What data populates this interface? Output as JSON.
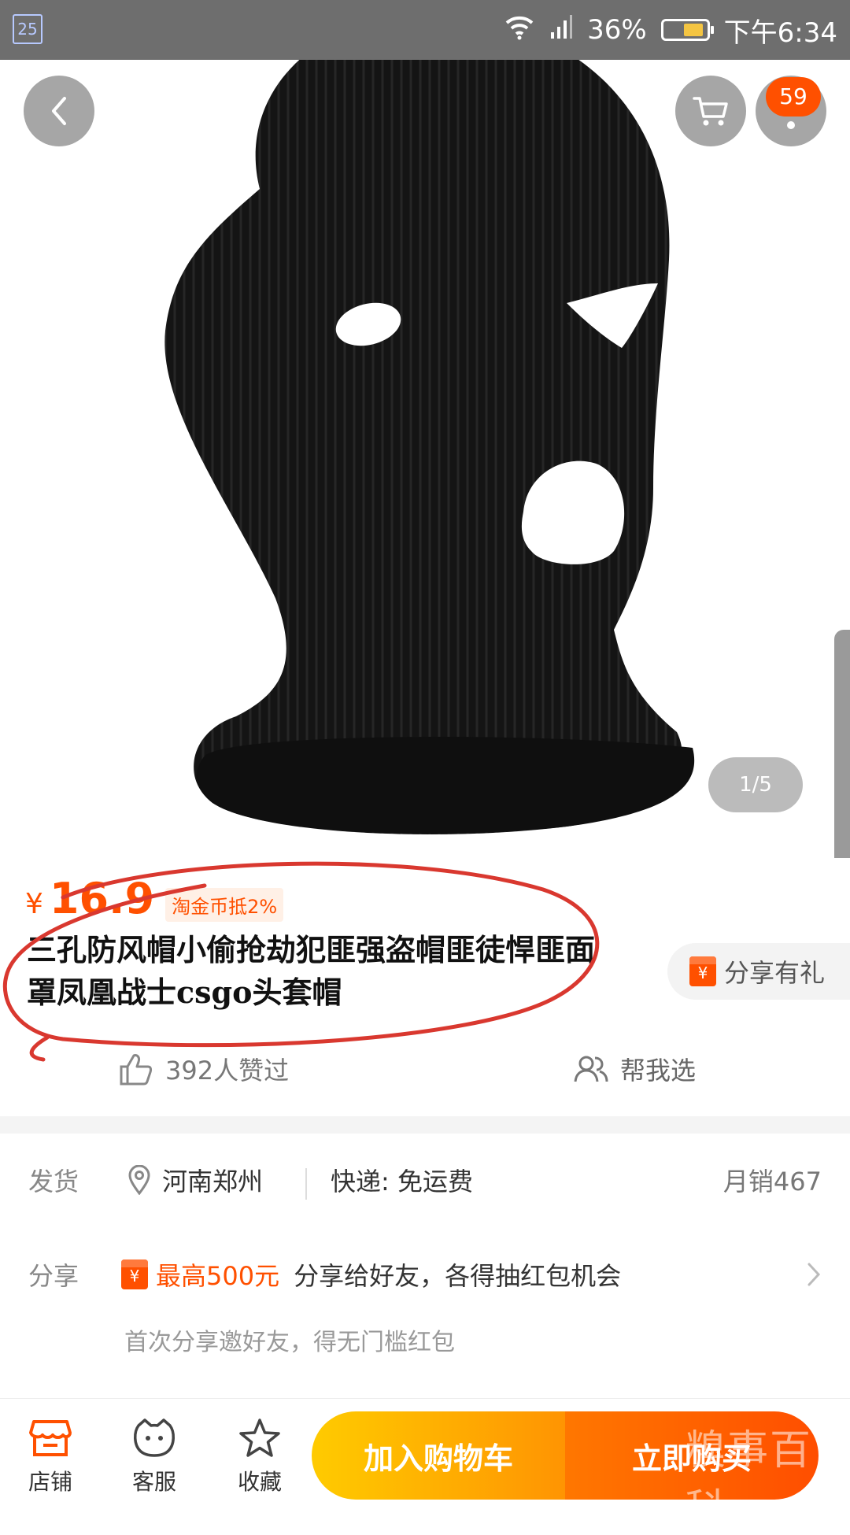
{
  "status_bar": {
    "notification_badge": "25",
    "battery_percent": "36%",
    "time": "下午6:34"
  },
  "header": {
    "message_count": "59"
  },
  "gallery": {
    "page_indicator": "1/5"
  },
  "product": {
    "currency": "¥",
    "price": "16.9",
    "coin_tag": "淘金币抵2%",
    "title": "三孔防风帽小偷抢劫犯匪强盗帽匪徒悍匪面罩凤凰战士csgo头套帽",
    "share_gift_label": "分享有礼",
    "likes_text": "392人赞过",
    "help_choose_label": "帮我选"
  },
  "shipping": {
    "label": "发货",
    "location": "河南郑州",
    "express": "快递: 免运费",
    "monthly_sales": "月销467"
  },
  "share": {
    "label": "分享",
    "highlight": "最高500元",
    "text": "分享给好友，各得抽红包机会",
    "sub_text": "首次分享邀好友，得无门槛红包"
  },
  "bottom_bar": {
    "shop_label": "店铺",
    "customer_service_label": "客服",
    "favorite_label": "收藏",
    "add_to_cart_label": "加入购物车",
    "buy_now_label": "立即购买"
  },
  "watermark": "糗事百科",
  "colors": {
    "accent": "#ff5000",
    "cart_gradient": [
      "#ffcb00",
      "#ff9402"
    ],
    "buy_gradient": [
      "#ff7700",
      "#ff4e00"
    ],
    "scribble": "#d9382f"
  },
  "icons": [
    "back-arrow-icon",
    "cart-icon",
    "more-icon",
    "thumbs-up-icon",
    "people-icon",
    "location-pin-icon",
    "red-packet-icon",
    "chevron-right-icon",
    "shop-icon",
    "customer-service-icon",
    "star-icon",
    "wifi-icon",
    "signal-icon",
    "battery-icon"
  ]
}
